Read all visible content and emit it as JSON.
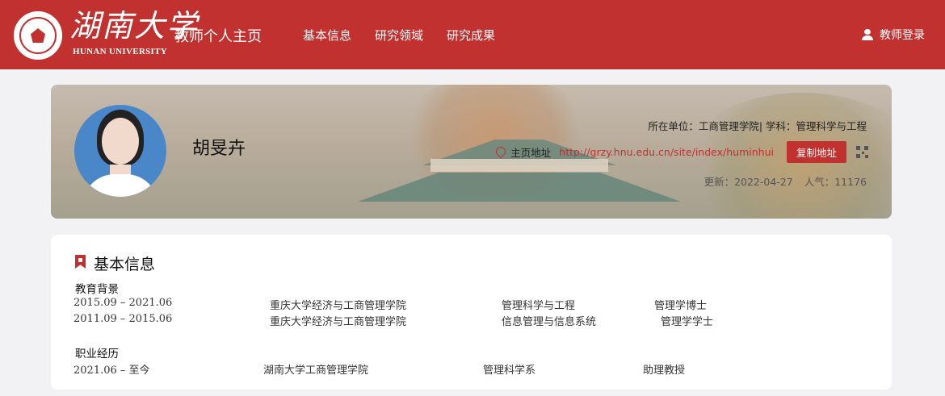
{
  "header": {
    "logo_cn": "湖南大学",
    "logo_en": "HUNAN UNIVERSITY",
    "site_title": "教师个人主页",
    "nav": [
      {
        "label": "基本信息"
      },
      {
        "label": "研究领域"
      },
      {
        "label": "研究成果"
      }
    ],
    "login_label": "教师登录"
  },
  "profile": {
    "name": "胡旻卉",
    "unit_line": "所在单位：工商管理学院| 学科：管理科学与工程",
    "address_label": "主页地址",
    "address_url": "http://grzy.hnu.edu.cn/site/index/huminhui",
    "copy_button": "复制地址",
    "updated": "更新：2022-04-27",
    "popularity": "人气：11176"
  },
  "basic_info": {
    "title": "基本信息",
    "education_label": "教育背景",
    "education": [
      {
        "period": "2015.09 – 2021.06",
        "school": "重庆大学经济与工商管理学院",
        "major": "管理科学与工程",
        "degree": "管理学博士"
      },
      {
        "period": "2011.09 – 2015.06",
        "school": "重庆大学经济与工商管理学院",
        "major": "信息管理与信息系统",
        "degree": "管理学学士"
      }
    ],
    "career_label": "职业经历",
    "career": [
      {
        "period": "2021.06 – 至今",
        "org": "湖南大学工商管理学院",
        "dept": "管理科学系",
        "title": "助理教授"
      }
    ]
  },
  "colors": {
    "brand": "#c0312f",
    "page_bg": "#f2f2f4"
  },
  "icons": [
    "seal-logo-icon",
    "user-icon",
    "location-pin-icon",
    "qr-code-icon",
    "bookmark-icon"
  ]
}
